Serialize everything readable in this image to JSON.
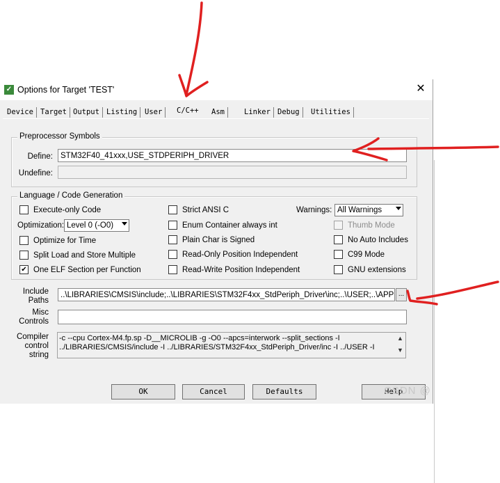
{
  "window": {
    "title": "Options for Target 'TEST'",
    "icon": "keil-uvision-icon",
    "close": "✕"
  },
  "tabs": [
    {
      "label": "Device"
    },
    {
      "label": "Target"
    },
    {
      "label": "Output"
    },
    {
      "label": "Listing"
    },
    {
      "label": "User"
    },
    {
      "label": "C/C++"
    },
    {
      "label": "Asm"
    },
    {
      "label": "Linker"
    },
    {
      "label": "Debug"
    },
    {
      "label": "Utilities"
    }
  ],
  "active_tab": "C/C++",
  "preprocessor": {
    "group_label": "Preprocessor Symbols",
    "define_label": "Define:",
    "define_value": "STM32F40_41xxx,USE_STDPERIPH_DRIVER",
    "undefine_label": "Undefine:",
    "undefine_value": ""
  },
  "language": {
    "group_label": "Language / Code Generation",
    "execute_only": {
      "label": "Execute-only Code",
      "checked": false
    },
    "optimization_label": "Optimization:",
    "optimization_value": "Level 0 (-O0)",
    "optimize_time": {
      "label": "Optimize for Time",
      "checked": false
    },
    "split_load": {
      "label": "Split Load and Store Multiple",
      "checked": false
    },
    "one_elf": {
      "label": "One ELF Section per Function",
      "checked": true
    },
    "strict_ansi": {
      "label": "Strict ANSI C",
      "checked": false
    },
    "enum_int": {
      "label": "Enum Container always int",
      "checked": false
    },
    "plain_char": {
      "label": "Plain Char is Signed",
      "checked": false
    },
    "ro_pi": {
      "label": "Read-Only Position Independent",
      "checked": false
    },
    "rw_pi": {
      "label": "Read-Write Position Independent",
      "checked": false
    },
    "warnings_label": "Warnings:",
    "warnings_value": "All Warnings",
    "thumb_mode": {
      "label": "Thumb Mode",
      "checked": false,
      "disabled": true
    },
    "no_auto_includes": {
      "label": "No Auto Includes",
      "checked": false
    },
    "c99_mode": {
      "label": "C99 Mode",
      "checked": false
    },
    "gnu_ext": {
      "label": "GNU extensions",
      "checked": false
    }
  },
  "paths": {
    "include_label_1": "Include",
    "include_label_2": "Paths",
    "include_value": "..\\LIBRARIES\\CMSIS\\include;..\\LIBRARIES\\STM32F4xx_StdPeriph_Driver\\inc;..\\USER;..\\APP;..\\F",
    "browse": "...",
    "misc_label_1": "Misc",
    "misc_label_2": "Controls",
    "misc_value": "",
    "compiler_label_1": "Compiler",
    "compiler_label_2": "control",
    "compiler_label_3": "string",
    "compiler_line_1": "-c --cpu Cortex-M4.fp.sp -D__MICROLIB -g -O0 --apcs=interwork --split_sections -I",
    "compiler_line_2": "../LIBRARIES/CMSIS/include -I ../LIBRARIES/STM32F4xx_StdPeriph_Driver/inc -I ../USER -I"
  },
  "buttons": {
    "ok": "OK",
    "cancel": "Cancel",
    "defaults": "Defaults",
    "help": "Help"
  },
  "watermark": "CSDN @",
  "colors": {
    "annotation": "#e02020",
    "dialog_bg": "#f0f0f0"
  }
}
